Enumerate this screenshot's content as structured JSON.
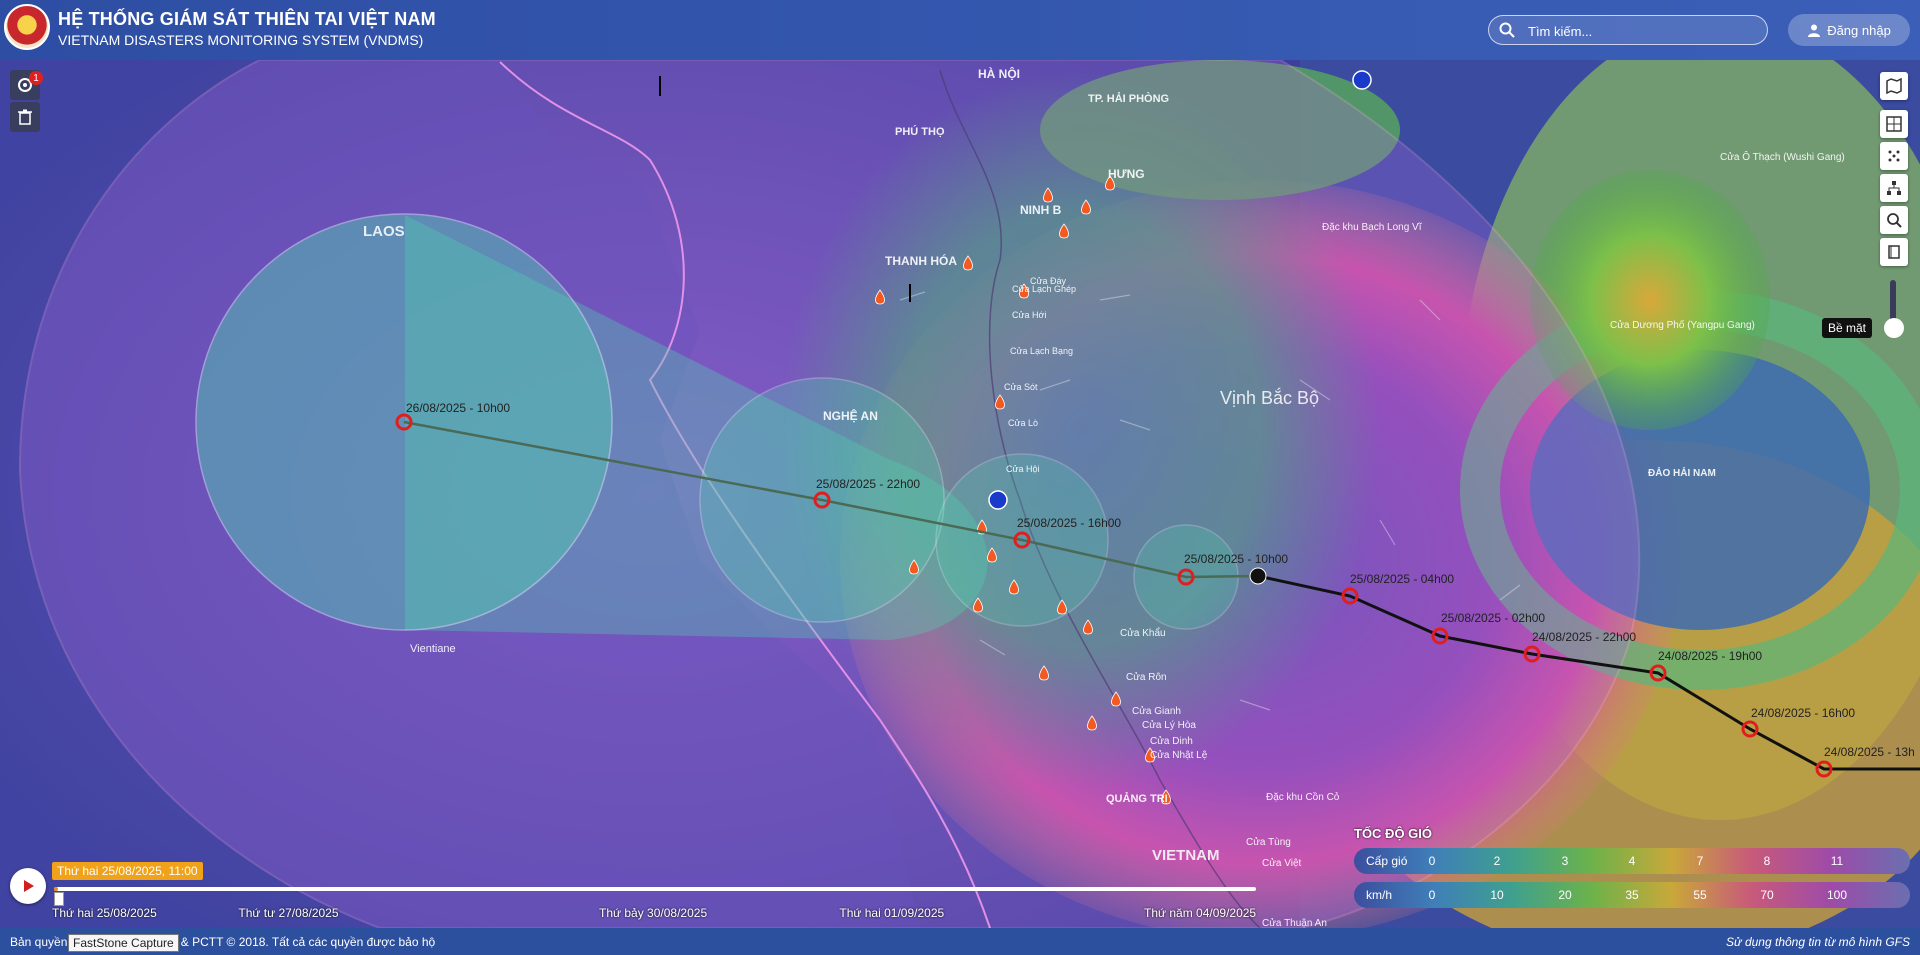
{
  "header": {
    "title_main": "HỆ THỐNG GIÁM SÁT THIÊN TAI VIỆT NAM",
    "title_sub": "VIETNAM DISASTERS MONITORING SYSTEM (VNDMS)",
    "search_placeholder": "Tìm kiếm...",
    "login_label": "Đăng nhập"
  },
  "left_tools": {
    "notification_count": "1"
  },
  "right_tools": {
    "layer_label": "Bề mặt"
  },
  "map": {
    "place_labels": [
      {
        "text": "HÀ NỘI"
      },
      {
        "text": "TP. HẢI PHÒNG"
      },
      {
        "text": "PHÚ THỌ"
      },
      {
        "text": "HƯNG"
      },
      {
        "text": "NINH B"
      },
      {
        "text": "THANH HÓA"
      },
      {
        "text": "LAOS"
      },
      {
        "text": "NGHỆ AN"
      },
      {
        "text": "Vịnh Bắc Bộ"
      },
      {
        "text": "Đặc khu Bạch Long Vĩ"
      },
      {
        "text": "ĐẢO HẢI NAM"
      },
      {
        "text": "Cửa Ô Thạch (Wushi Gang)"
      },
      {
        "text": "Cửa Dương Phố (Yangpu Gang)"
      },
      {
        "text": "Vientiane"
      },
      {
        "text": "QUẢNG TRỊ"
      },
      {
        "text": "VIETNAM"
      },
      {
        "text": "Đặc khu Cồn Cỏ"
      },
      {
        "text": "Cửa Tùng"
      },
      {
        "text": "Cửa Việt"
      },
      {
        "text": "Cửa Thuận An"
      },
      {
        "text": "Cửa Khẩu"
      },
      {
        "text": "Cửa Rôn"
      },
      {
        "text": "Cửa Gianh"
      },
      {
        "text": "Cửa Lý Hòa"
      },
      {
        "text": "Cửa Dinh"
      },
      {
        "text": "Cửa Nhật Lệ"
      },
      {
        "text": "Cửa Lò"
      },
      {
        "text": "Cửa Hội"
      },
      {
        "text": "Cửa Sót"
      },
      {
        "text": "Cửa Lạch Bạng"
      },
      {
        "text": "Cửa Hới"
      },
      {
        "text": "Cửa Lạch Ghép"
      },
      {
        "text": "Cửa Đáy"
      }
    ],
    "storm_track": [
      {
        "label": "26/08/2025 - 10h00",
        "kind": "forecast"
      },
      {
        "label": "25/08/2025 - 22h00",
        "kind": "forecast"
      },
      {
        "label": "25/08/2025 - 16h00",
        "kind": "forecast"
      },
      {
        "label": "25/08/2025 - 10h00",
        "kind": "forecast"
      },
      {
        "label": "",
        "kind": "current"
      },
      {
        "label": "25/08/2025 - 04h00",
        "kind": "past"
      },
      {
        "label": "25/08/2025 - 02h00",
        "kind": "past"
      },
      {
        "label": "24/08/2025 - 22h00",
        "kind": "past"
      },
      {
        "label": "24/08/2025 - 19h00",
        "kind": "past"
      },
      {
        "label": "24/08/2025 - 16h00",
        "kind": "past"
      },
      {
        "label": "24/08/2025 - 13h",
        "kind": "past"
      }
    ]
  },
  "timeline": {
    "current_date": "Thứ hai 25/08/2025, 11:00",
    "progress": 0.002,
    "ticks": [
      {
        "label": "Thứ hai 25/08/2025",
        "position": 0.0
      },
      {
        "label": "Thứ tư 27/08/2025",
        "position": 0.2
      },
      {
        "label": "Thứ bảy 30/08/2025",
        "position": 0.5
      },
      {
        "label": "Thứ hai 01/09/2025",
        "position": 0.7
      },
      {
        "label": "Thứ năm 04/09/2025",
        "position": 1.0
      }
    ]
  },
  "legend": {
    "title": "TỐC ĐỘ GIÓ",
    "rows": [
      {
        "name": "Cấp gió",
        "values": [
          "0",
          "2",
          "3",
          "4",
          "7",
          "8",
          "11"
        ]
      },
      {
        "name": "km/h",
        "values": [
          "0",
          "10",
          "20",
          "35",
          "55",
          "70",
          "100"
        ]
      }
    ]
  },
  "footer": {
    "copyright": "Bản quyền thuộc về Cục QLĐĐ & PCTT © 2018. Tất cả các quyền được bảo hộ",
    "gfs_note": "Sử dụng thông tin từ mô hình GFS",
    "tooltip": "FastStone Capture"
  },
  "colors": {
    "header": "#2d4ea3",
    "accent": "#f0a21a",
    "storm": "#e01e1e",
    "footer": "#2c4f9e"
  }
}
